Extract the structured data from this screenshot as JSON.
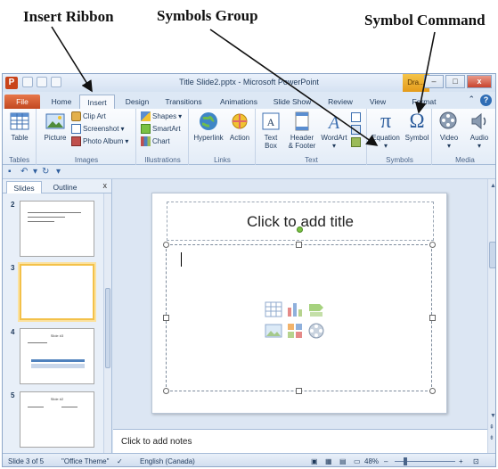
{
  "annotations": {
    "insert_ribbon": "Insert Ribbon",
    "symbols_group": "Symbols Group",
    "symbol_command": "Symbol Command"
  },
  "window": {
    "app_logo": "P",
    "title": "Title Slide2.pptx - Microsoft PowerPoint",
    "drawing_tab": "Dra...",
    "min": "–",
    "max": "□",
    "close": "x"
  },
  "tabs": {
    "file": "File",
    "home": "Home",
    "insert": "Insert",
    "design": "Design",
    "transitions": "Transitions",
    "animations": "Animations",
    "slideshow": "Slide Show",
    "review": "Review",
    "view": "View",
    "format": "Format",
    "help": "?"
  },
  "ribbon": {
    "tables": {
      "label": "Tables",
      "table": "Table"
    },
    "images": {
      "label": "Images",
      "picture": "Picture",
      "clip_art": "Clip Art",
      "screenshot": "Screenshot",
      "photo_album": "Photo Album"
    },
    "illustrations": {
      "label": "Illustrations",
      "shapes": "Shapes",
      "smartart": "SmartArt",
      "chart": "Chart"
    },
    "links": {
      "label": "Links",
      "hyperlink": "Hyperlink",
      "action": "Action"
    },
    "text": {
      "label": "Text",
      "text_box_1": "Text",
      "text_box_2": "Box",
      "header_1": "Header",
      "header_2": "& Footer",
      "wordart": "WordArt"
    },
    "symbols": {
      "label": "Symbols",
      "equation": "Equation",
      "symbol": "Symbol",
      "pi": "π",
      "omega": "Ω"
    },
    "media": {
      "label": "Media",
      "video": "Video",
      "audio": "Audio"
    }
  },
  "slides_panel": {
    "tab_slides": "Slides",
    "tab_outline": "Outline",
    "close": "x",
    "thumbs": [
      {
        "num": "2"
      },
      {
        "num": "3"
      },
      {
        "num": "4",
        "title": "Slide #3"
      },
      {
        "num": "5",
        "title": "Slide #2"
      }
    ]
  },
  "slide": {
    "title_placeholder": "Click to add title"
  },
  "notes": {
    "placeholder": "Click to add notes"
  },
  "status": {
    "slide_of": "Slide 3 of 5",
    "theme": "\"Office Theme\"",
    "language": "English (Canada)",
    "zoom": "48%",
    "zoom_minus": "–",
    "zoom_plus": "+"
  },
  "colors": {
    "file_tab": "#c24820",
    "accent_blue": "#2f6db5",
    "selection": "#f3c14a"
  }
}
